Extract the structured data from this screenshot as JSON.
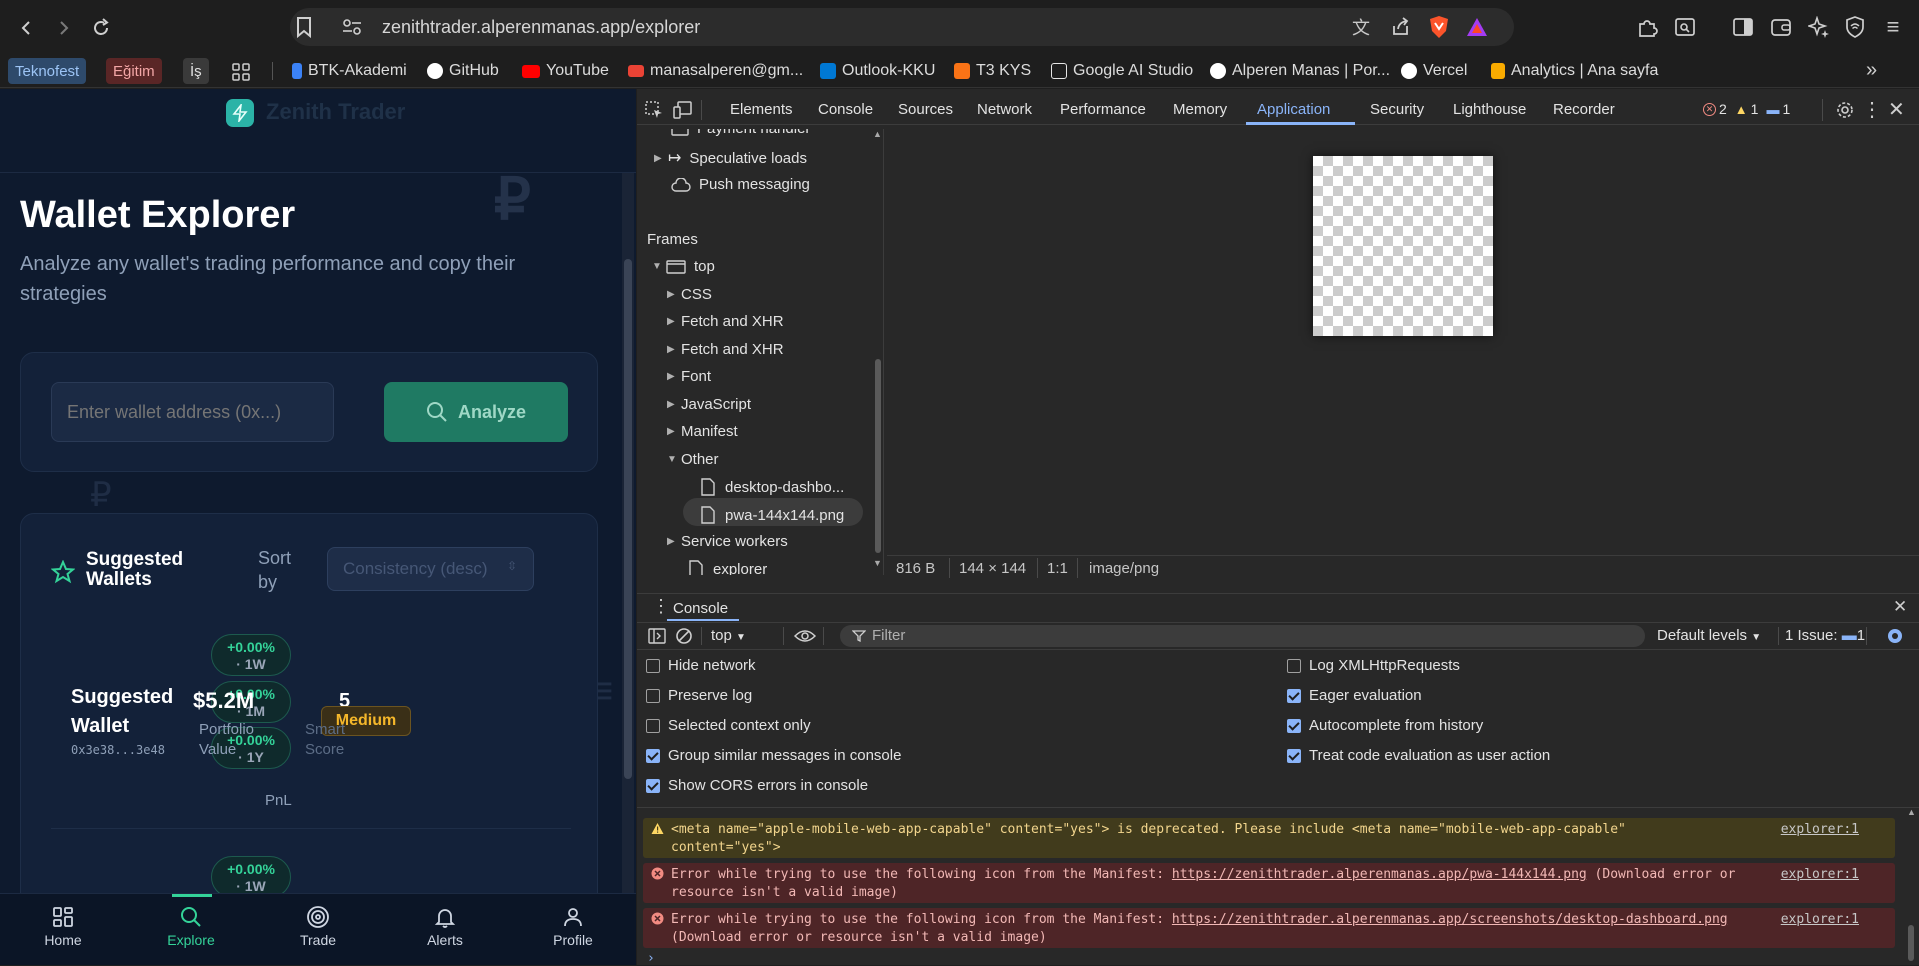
{
  "browser": {
    "url": "zenithtrader.alperenmanas.app/explorer",
    "bookmarks_tags": [
      {
        "label": "Teknofest",
        "bg": "#2e4a6b",
        "fg": "#9cc4f5"
      },
      {
        "label": "Eğitim",
        "bg": "#5a2626",
        "fg": "#f3a6a6"
      },
      {
        "label": "İş",
        "bg": "#3a3a3a",
        "fg": "#e0e0e0"
      }
    ],
    "bookmarks": [
      {
        "label": "BTK-Akademi",
        "color": "#3b82f6"
      },
      {
        "label": "GitHub",
        "color": "#ffffff"
      },
      {
        "label": "YouTube",
        "color": "#ff0000"
      },
      {
        "label": "manasalperen@gm...",
        "color": "#ea4335"
      },
      {
        "label": "Outlook-KKU",
        "color": "#0078d4"
      },
      {
        "label": "T3 KYS",
        "color": "#f97316"
      },
      {
        "label": "Google AI Studio",
        "color": "#e5e5e5"
      },
      {
        "label": "Alperen Manas | Por...",
        "color": "#ffffff"
      },
      {
        "label": "Vercel",
        "color": "#ffffff"
      },
      {
        "label": "Analytics | Ana sayfa",
        "color": "#f9ab00"
      }
    ]
  },
  "app": {
    "brand": "Zenith Trader",
    "title": "Wallet Explorer",
    "subtitle": "Analyze any wallet's trading performance and copy their strategies",
    "search_placeholder": "Enter wallet address (0x...)",
    "analyze_label": "Analyze",
    "suggested": {
      "heading": "Suggested Wallets",
      "sort_label": "Sort by",
      "sort_value": "Consistency (desc)",
      "wallet_name": "Suggested Wallet",
      "wallet_addr": "0x3e38...3e48",
      "portfolio_value": "$5.2M",
      "portfolio_label": "Portfolio Value",
      "pnl_label": "PnL",
      "pnls": [
        {
          "value": "+0.00%",
          "period": "· 1W"
        },
        {
          "value": "+0.00%",
          "period": "· 1M"
        },
        {
          "value": "+0.00%",
          "period": "· 1Y"
        }
      ],
      "score": "5",
      "score_level": "Medium",
      "score_label": "Smart Score",
      "next_pnl": {
        "value": "+0.00%",
        "period": "· 1W"
      }
    },
    "nav": [
      {
        "label": "Home",
        "icon": "grid-icon"
      },
      {
        "label": "Explore",
        "icon": "search-icon"
      },
      {
        "label": "Trade",
        "icon": "target-icon"
      },
      {
        "label": "Alerts",
        "icon": "bell-icon"
      },
      {
        "label": "Profile",
        "icon": "user-icon"
      }
    ],
    "accent": "#1f7a63"
  },
  "devtools": {
    "tabs": [
      "Elements",
      "Console",
      "Sources",
      "Network",
      "Performance",
      "Memory",
      "Application",
      "Security",
      "Lighthouse",
      "Recorder"
    ],
    "active_tab": "Application",
    "counts": {
      "errors": "2",
      "warnings": "1",
      "info": "1"
    },
    "sidebar": {
      "payment": "Payment handler",
      "speculative": "Speculative loads",
      "push": "Push messaging",
      "frames_header": "Frames",
      "top": "top",
      "children": [
        "CSS",
        "Fetch and XHR",
        "Fetch and XHR",
        "Font",
        "JavaScript",
        "Manifest",
        "Other"
      ],
      "other_items": [
        "desktop-dashbo...",
        "pwa-144x144.png"
      ],
      "service_workers": "Service workers",
      "explorer": "explorer"
    },
    "preview_footer": [
      "816 B",
      "144 × 144",
      "1:1",
      "image/png"
    ],
    "console": {
      "drawer_tab": "Console",
      "context": "top",
      "filter_placeholder": "Filter",
      "levels": "Default levels",
      "issues": "1 Issue:",
      "issues_count": "1",
      "options_left": [
        {
          "label": "Hide network",
          "checked": false
        },
        {
          "label": "Preserve log",
          "checked": false
        },
        {
          "label": "Selected context only",
          "checked": false
        },
        {
          "label": "Group similar messages in console",
          "checked": true
        },
        {
          "label": "Show CORS errors in console",
          "checked": true
        }
      ],
      "options_right": [
        {
          "label": "Log XMLHttpRequests",
          "checked": false
        },
        {
          "label": "Eager evaluation",
          "checked": true
        },
        {
          "label": "Autocomplete from history",
          "checked": true
        },
        {
          "label": "Treat code evaluation as user action",
          "checked": true
        }
      ],
      "messages": [
        {
          "type": "warn",
          "text": "<meta name=\"apple-mobile-web-app-capable\" content=\"yes\"> is deprecated. Please include <meta name=\"mobile-web-app-capable\" content=\"yes\">",
          "source": "explorer:1"
        },
        {
          "type": "err",
          "pre": "Error while trying to use the following icon from the Manifest: ",
          "link": "https://zenithtrader.alperenmanas.app/pwa-144x144.png",
          "post": " (Download error or resource isn't a valid image)",
          "source": "explorer:1"
        },
        {
          "type": "err",
          "pre": "Error while trying to use the following icon from the Manifest: ",
          "link": "https://zenithtrader.alperenmanas.app/screenshots/desktop-dashboard.png",
          "post": " (Download error or resource isn't a valid image)",
          "source": "explorer:1"
        }
      ]
    }
  }
}
